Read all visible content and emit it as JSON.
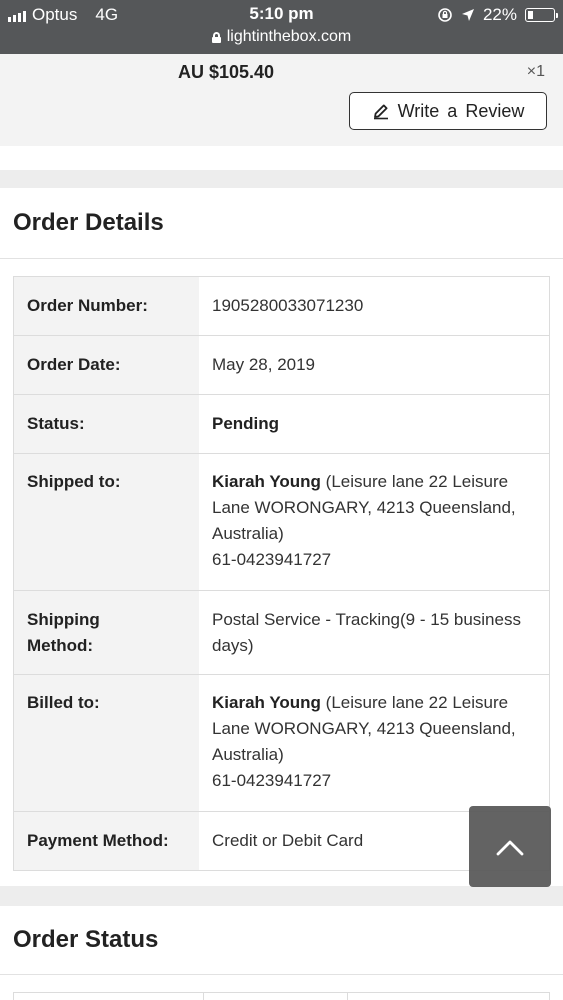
{
  "status_bar": {
    "carrier": "Optus",
    "network": "4G",
    "time": "5:10 pm",
    "url": "lightinthebox.com",
    "battery": "22%",
    "battery_level": 0.22
  },
  "product": {
    "price": "AU $105.40",
    "quantity": "×1",
    "review_label": "Write a Review"
  },
  "order_details": {
    "title": "Order Details",
    "rows": [
      {
        "label": "Order Number:",
        "value": "1905280033071230"
      },
      {
        "label": "Order Date:",
        "value": "May 28, 2019"
      },
      {
        "label": "Status:",
        "value": "Pending"
      },
      {
        "label": "Shipped to:",
        "name": "Kiarah Young",
        "address": " (Leisure lane 22 Leisure Lane WORONGARY, 4213 Queensland, Australia)",
        "phone": "61-0423941727"
      },
      {
        "label": "Shipping Method:",
        "value": "Postal Service - Tracking(9 - 15 business days)"
      },
      {
        "label": "Billed to:",
        "name": "Kiarah Young",
        "address": " (Leisure lane 22 Leisure Lane WORONGARY, 4213 Queensland, Australia)",
        "phone": "61-0423941727"
      },
      {
        "label": "Payment Method:",
        "value": "Credit or Debit Card"
      }
    ]
  },
  "order_status": {
    "title": "Order Status"
  },
  "icons": {
    "pencil": "pencil-icon",
    "back_to_top": "chevron-up-icon",
    "lock": "lock-icon"
  }
}
